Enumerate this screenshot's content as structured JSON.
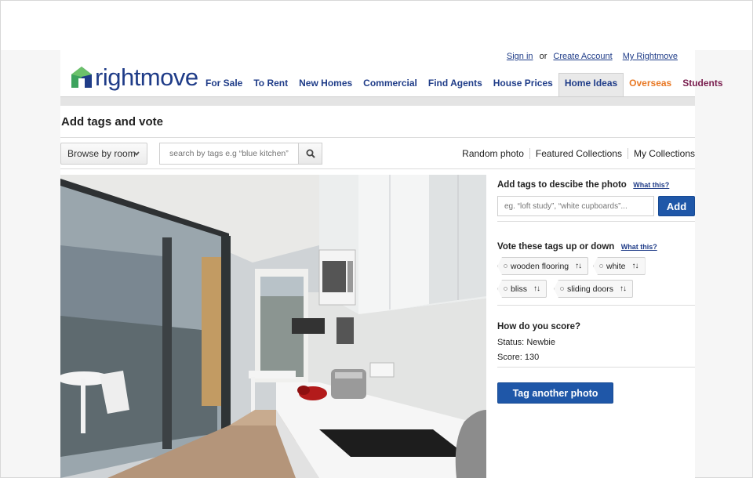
{
  "account": {
    "sign_in": "Sign in",
    "or": "or",
    "create_account": "Create Account",
    "my_rightmove": "My Rightmove"
  },
  "logo": {
    "text": "rightmove",
    "icon": "house-logo-icon",
    "colors": [
      "#1f3c88",
      "#3da35d"
    ]
  },
  "nav": {
    "items": [
      "For Sale",
      "To Rent",
      "New Homes",
      "Commercial",
      "Find Agents",
      "House Prices",
      "Home Ideas",
      "Overseas",
      "Students"
    ],
    "active": "Home Ideas",
    "overseas_color": "#e87722",
    "students_color": "#7a1f4f"
  },
  "page": {
    "title": "Add tags and vote"
  },
  "toolbar": {
    "browse_label": "Browse by room",
    "search_placeholder": "search by tags e.g “blue kitchen”",
    "links": [
      "Random photo",
      "Featured Collections",
      "My Collections"
    ]
  },
  "photo": {
    "subject": "kitchen-photo"
  },
  "add_tags": {
    "heading": "Add tags to descibe the photo",
    "what_this": "What this?",
    "placeholder": "eg. “loft study”, “white cupboards”...",
    "button": "Add"
  },
  "vote": {
    "heading": "Vote these tags up or down",
    "what_this": "What this?",
    "tags": [
      "wooden flooring",
      "white",
      "bliss",
      "sliding doors"
    ],
    "arrows": "↑↓"
  },
  "score": {
    "heading": "How do you score?",
    "status_label": "Status:",
    "status_value": "Newbie",
    "score_label": "Score:",
    "score_value": "130"
  },
  "actions": {
    "tag_another": "Tag another photo",
    "button_color": "#1f57a8"
  }
}
